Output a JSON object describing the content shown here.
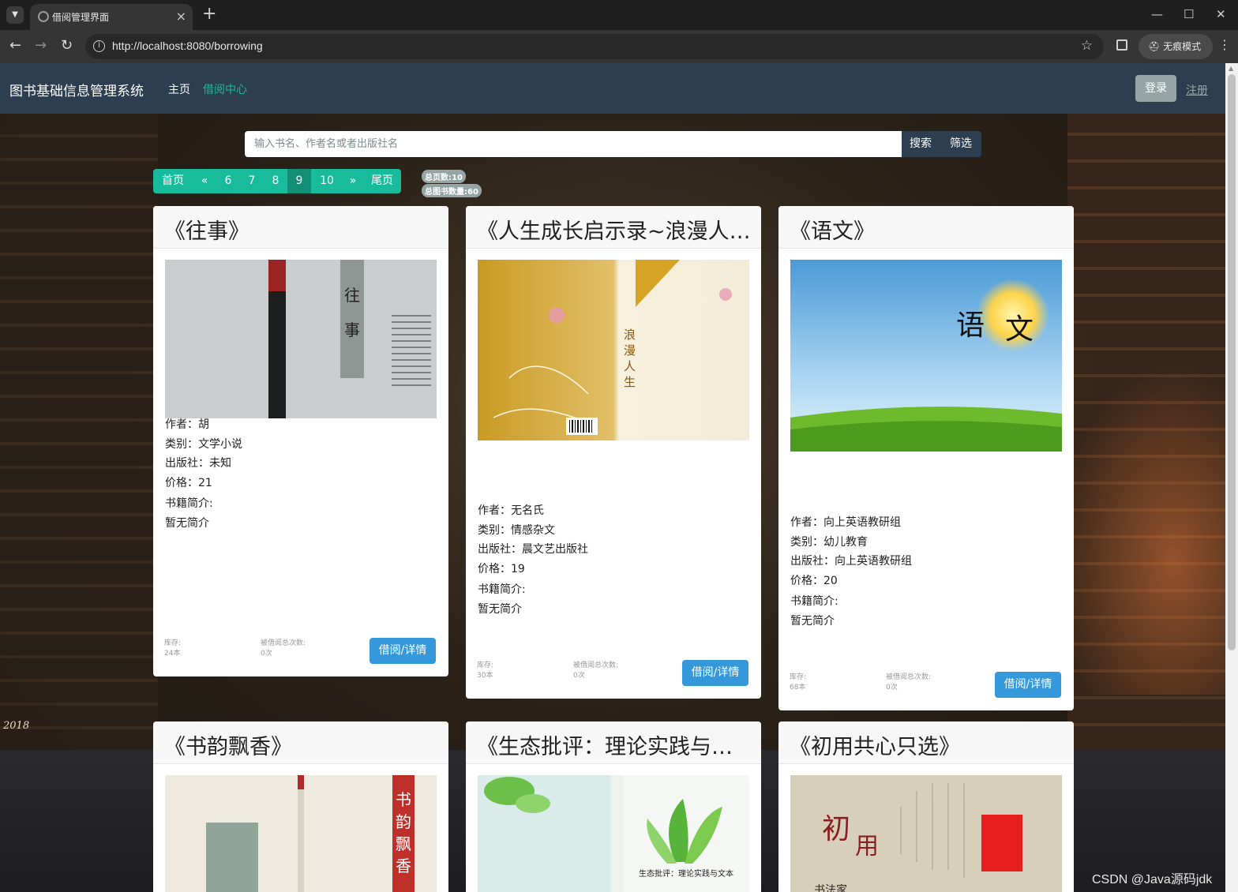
{
  "browser": {
    "tab_title": "借阅管理界面",
    "url": "http://localhost:8080/borrowing",
    "incognito_label": "无痕模式"
  },
  "navbar": {
    "brand": "图书基础信息管理系统",
    "links": [
      "主页",
      "借阅中心"
    ],
    "active_link": "借阅中心",
    "login": "登录",
    "register": "注册"
  },
  "search": {
    "placeholder": "输入书名、作者名或者出版社名",
    "search_button": "搜索",
    "filter_button": "筛选"
  },
  "pagination": {
    "first": "首页",
    "prev": "«",
    "pages": [
      "6",
      "7",
      "8",
      "9",
      "10"
    ],
    "active_page": "9",
    "next": "»",
    "last": "尾页",
    "total_pages": "总页数:10",
    "total_books": "总图书数量:60"
  },
  "labels": {
    "author": "作者：",
    "category": "类别：",
    "publisher": "出版社：",
    "price": "价格：",
    "intro": "书籍简介:",
    "stock": "库存:",
    "borrow_count": "被借阅总次数:",
    "borrow_button": "借阅/详情"
  },
  "books": [
    {
      "title": "《往事》",
      "author": "胡",
      "category": "文学小说",
      "publisher": "未知",
      "price": "21",
      "intro": "暂无简介",
      "stock": "24本",
      "borrow_count": "0次",
      "cover_text": "往事"
    },
    {
      "title": "《人生成长启示录~浪漫人生》",
      "author": "无名氏",
      "category": "情感杂文",
      "publisher": "晨文艺出版社",
      "price": "19",
      "intro": "暂无简介",
      "stock": "30本",
      "borrow_count": "0次",
      "cover_text": "浪漫人生"
    },
    {
      "title": "《语文》",
      "author": "向上英语教研组",
      "category": "幼儿教育",
      "publisher": "向上英语教研组",
      "price": "20",
      "intro": "暂无简介",
      "stock": "68本",
      "borrow_count": "0次",
      "cover_text": "语文"
    },
    {
      "title": "《书韵飘香》",
      "cover_text": "书韵飘香"
    },
    {
      "title": "《生态批评：理论实践与文本》",
      "cover_text": "生态批评：理论实践与文本"
    },
    {
      "title": "《初用共心只选》",
      "cover_text": "书法家"
    }
  ],
  "watermark": "CSDN @Java源码jdk",
  "year_mark": "2018",
  "colors": {
    "navbar": "#2c3e50",
    "accent": "#18bc9c",
    "primary": "#3498db",
    "muted": "#95a5a6"
  }
}
